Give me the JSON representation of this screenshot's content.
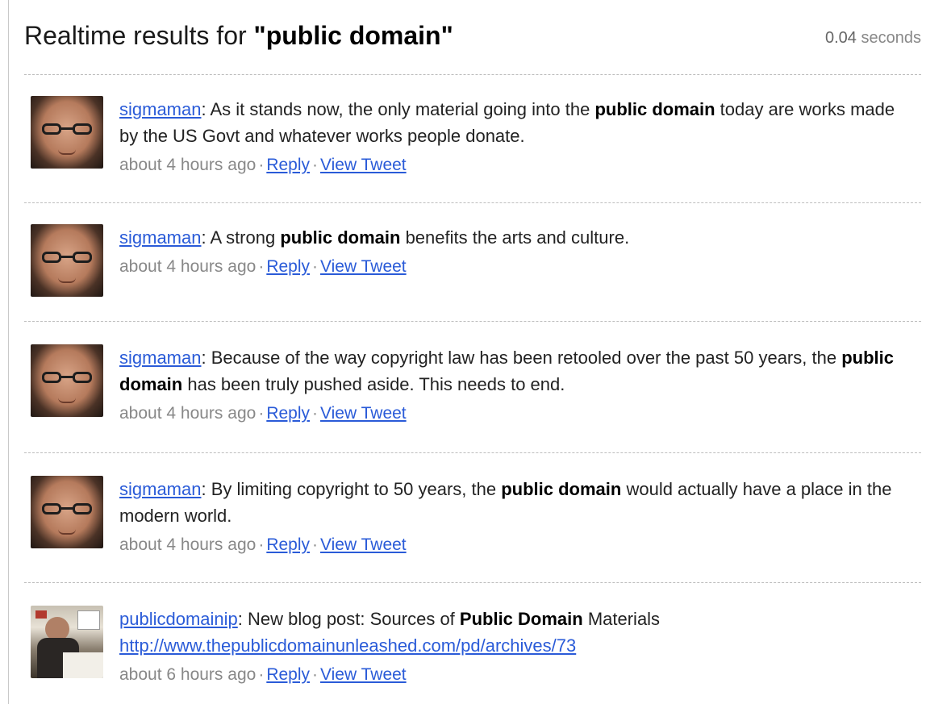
{
  "header": {
    "title_prefix": "Realtime results for ",
    "query": "\"public domain\"",
    "time_value": "0.04",
    "time_unit": "seconds"
  },
  "tweets": [
    {
      "user": "sigmaman",
      "avatar": "man-with-glasses-avatar",
      "parts": [
        ": As it stands now, the only material going into the ",
        "public domain",
        " today are works made by the US Govt and whatever works people donate."
      ],
      "time": "about 4 hours ago",
      "reply": "Reply",
      "view": "View Tweet"
    },
    {
      "user": "sigmaman",
      "avatar": "man-with-glasses-avatar",
      "parts": [
        ": A strong ",
        "public domain",
        " benefits the arts and culture."
      ],
      "time": "about 4 hours ago",
      "reply": "Reply",
      "view": "View Tweet"
    },
    {
      "user": "sigmaman",
      "avatar": "man-with-glasses-avatar",
      "parts": [
        ": Because of the way copyright law has been retooled over the past 50 years, the ",
        "public domain",
        " has been truly pushed aside. This needs to end."
      ],
      "time": "about 4 hours ago",
      "reply": "Reply",
      "view": "View Tweet"
    },
    {
      "user": "sigmaman",
      "avatar": "man-with-glasses-avatar",
      "parts": [
        ": By limiting copyright to 50 years, the ",
        "public domain",
        " would actually have a place in the modern world."
      ],
      "time": "about 4 hours ago",
      "reply": "Reply",
      "view": "View Tweet"
    },
    {
      "user": "publicdomainip",
      "avatar": "man-at-desk-avatar",
      "parts": [
        ": New blog post: Sources of ",
        "Public Domain",
        " Materials"
      ],
      "link": "http://www.thepublicdomainunleashed.com/pd/archives/73",
      "time": "about 6 hours ago",
      "reply": "Reply",
      "view": "View Tweet"
    }
  ],
  "separator": "·"
}
